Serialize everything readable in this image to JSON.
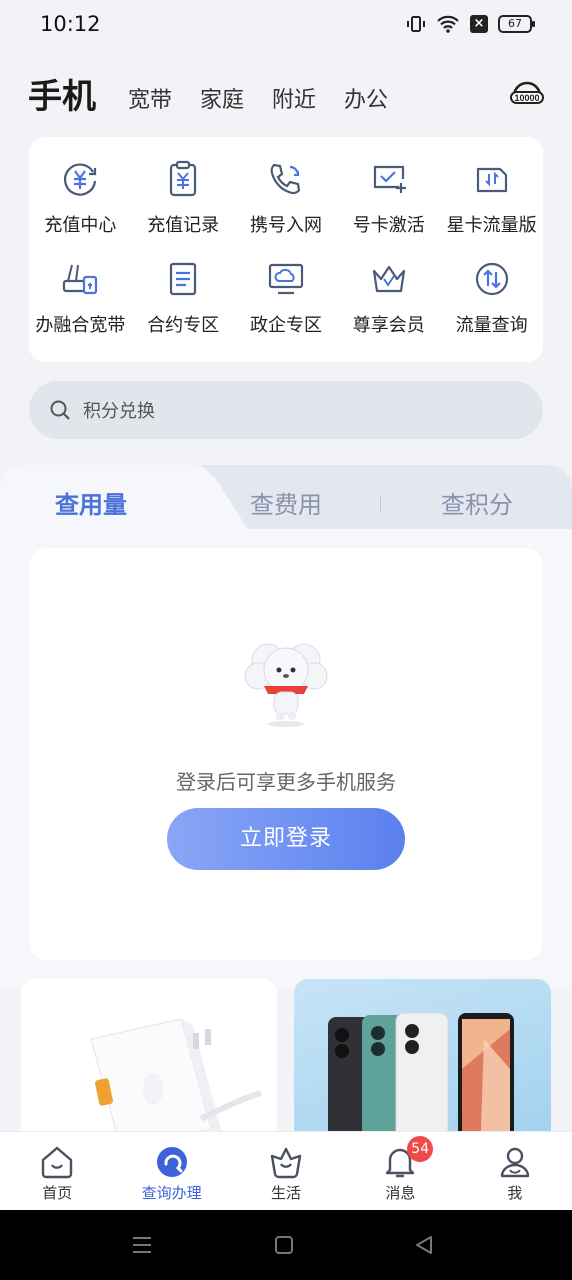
{
  "status_bar": {
    "time": "10:12",
    "battery": "67"
  },
  "top_tabs": [
    {
      "label": "手机",
      "active": true
    },
    {
      "label": "宽带"
    },
    {
      "label": "家庭"
    },
    {
      "label": "附近"
    },
    {
      "label": "办公"
    }
  ],
  "hotline_icon_text": "10000",
  "services": [
    {
      "label": "充值中心",
      "icon": "yuan-circle-icon"
    },
    {
      "label": "充值记录",
      "icon": "clipboard-yuan-icon"
    },
    {
      "label": "携号入网",
      "icon": "phone-transfer-icon"
    },
    {
      "label": "号卡激活",
      "icon": "sim-activate-icon"
    },
    {
      "label": "星卡流量版",
      "icon": "data-card-icon"
    },
    {
      "label": "办融合宽带",
      "icon": "router-icon"
    },
    {
      "label": "合约专区",
      "icon": "document-icon"
    },
    {
      "label": "政企专区",
      "icon": "cloud-monitor-icon"
    },
    {
      "label": "尊享会员",
      "icon": "crown-icon"
    },
    {
      "label": "流量查询",
      "icon": "arrows-updown-icon"
    }
  ],
  "search": {
    "placeholder": "积分兑换"
  },
  "usage_tabs": [
    {
      "label": "查用量",
      "active": true
    },
    {
      "label": "查费用"
    },
    {
      "label": "查积分"
    }
  ],
  "login_card": {
    "hint": "登录后可享更多手机服务",
    "button": "立即登录"
  },
  "bottom_nav": [
    {
      "label": "首页",
      "icon": "home-icon"
    },
    {
      "label": "查询办理",
      "icon": "query-icon",
      "active": true
    },
    {
      "label": "生活",
      "icon": "life-icon"
    },
    {
      "label": "消息",
      "icon": "bell-icon",
      "badge": "54"
    },
    {
      "label": "我",
      "icon": "user-icon"
    }
  ],
  "colors": {
    "accent": "#4b72d8",
    "badge": "#f04a4a",
    "icon_stroke": "#4a5b7a"
  }
}
